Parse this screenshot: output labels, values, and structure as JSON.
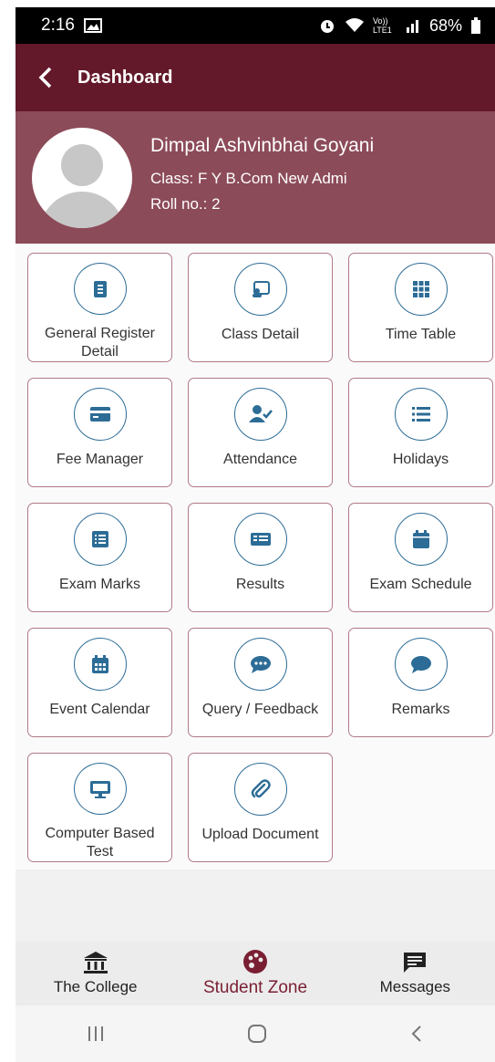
{
  "status": {
    "time": "2:16",
    "network": "Vo)) LTE1",
    "battery": "68%"
  },
  "appbar": {
    "title": "Dashboard"
  },
  "profile": {
    "name": "Dimpal Ashvinbhai Goyani",
    "class_line": "Class: F Y B.Com New Admi",
    "roll_line": "Roll no.: 2"
  },
  "tiles": [
    {
      "label": "General Register Detail",
      "icon": "contact-book-icon"
    },
    {
      "label": "Class Detail",
      "icon": "classroom-icon"
    },
    {
      "label": "Time Table",
      "icon": "grid-icon"
    },
    {
      "label": "Fee Manager",
      "icon": "credit-card-icon"
    },
    {
      "label": "Attendance",
      "icon": "user-check-icon"
    },
    {
      "label": "Holidays",
      "icon": "list-icon"
    },
    {
      "label": "Exam Marks",
      "icon": "list-box-icon"
    },
    {
      "label": "Results",
      "icon": "receipt-icon"
    },
    {
      "label": "Exam Schedule",
      "icon": "calendar-icon"
    },
    {
      "label": "Event Calendar",
      "icon": "calendar-grid-icon"
    },
    {
      "label": "Query / Feedback",
      "icon": "chat-dots-icon"
    },
    {
      "label": "Remarks",
      "icon": "chat-bubble-icon"
    },
    {
      "label": "Computer Based Test",
      "icon": "monitor-icon"
    },
    {
      "label": "Upload Document",
      "icon": "paperclip-icon"
    }
  ],
  "bottom_nav": [
    {
      "label": "The College",
      "icon": "bank-icon",
      "active": false
    },
    {
      "label": "Student Zone",
      "icon": "palette-icon",
      "active": true
    },
    {
      "label": "Messages",
      "icon": "message-icon",
      "active": false
    }
  ],
  "colors": {
    "appbar": "#63192a",
    "profile_bg": "#8c4b59",
    "icon_blue": "#2c6c96",
    "active_nav": "#7a1f33"
  }
}
